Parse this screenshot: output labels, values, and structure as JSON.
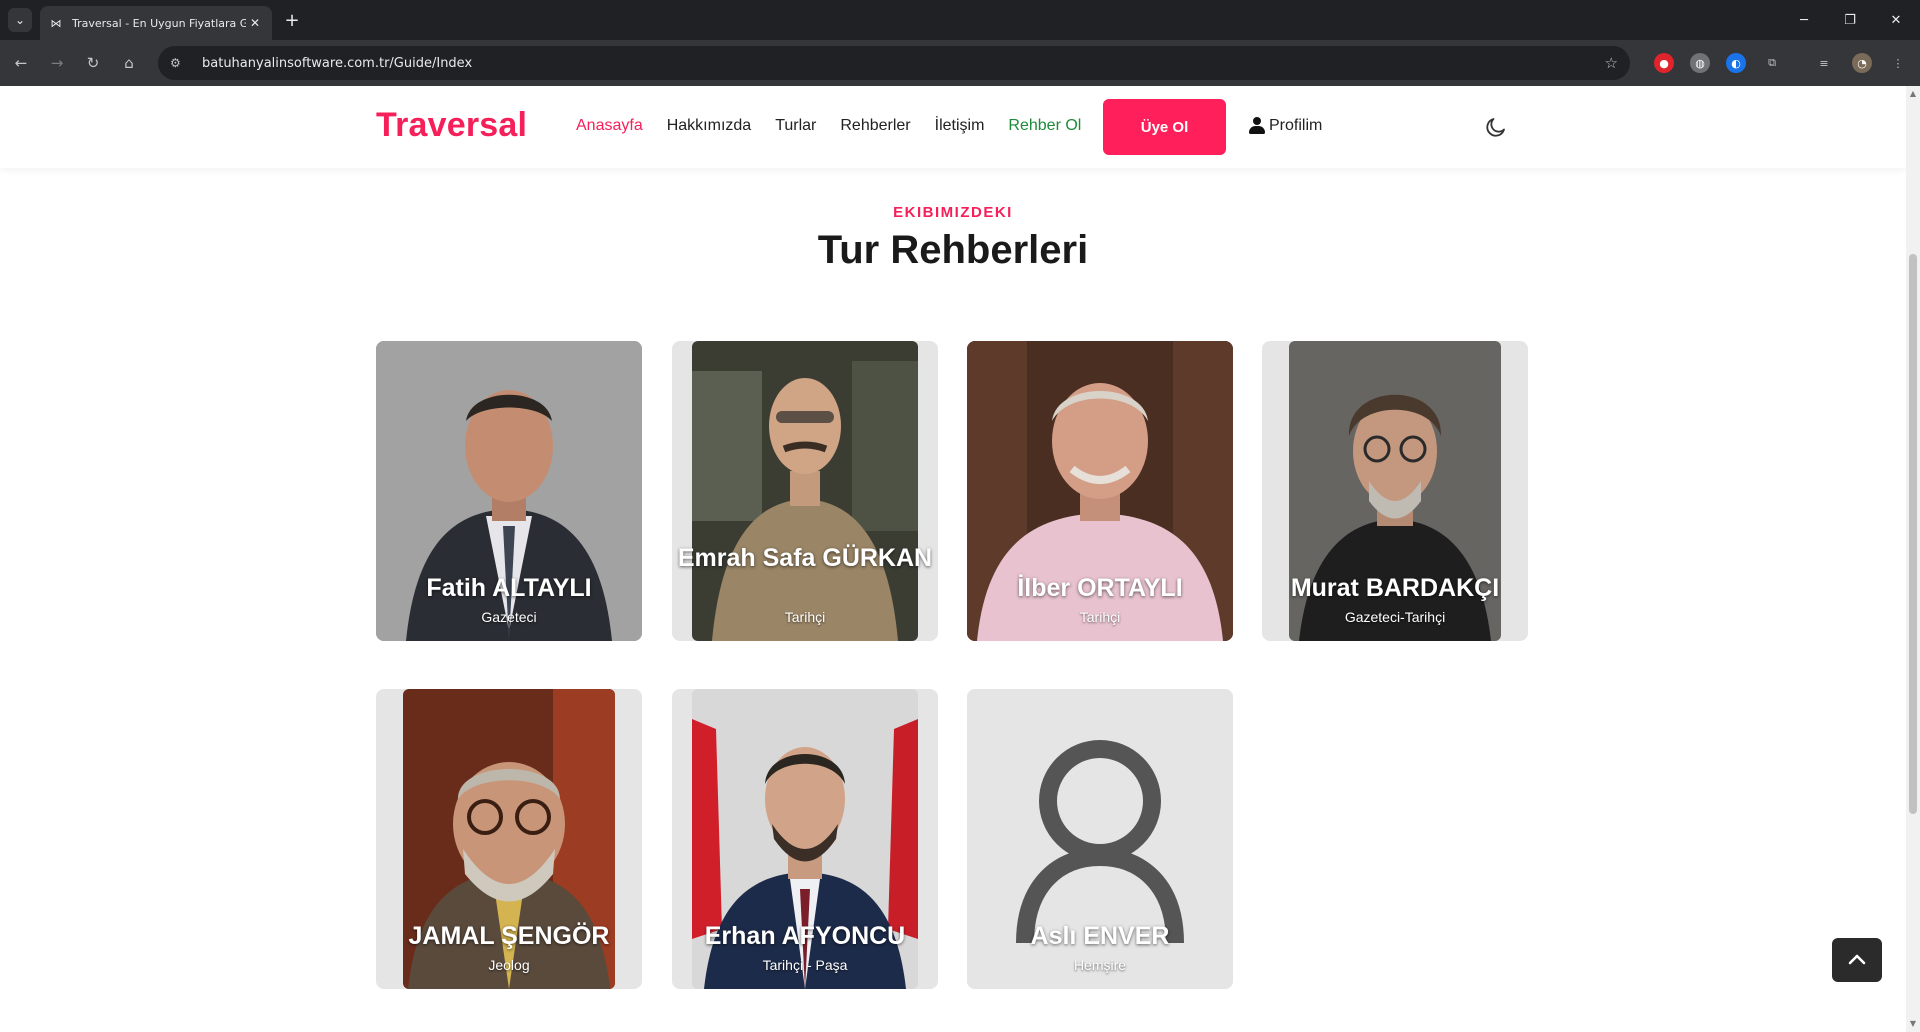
{
  "browser": {
    "tab_title": "Traversal - En Uygun Fiyatlara G",
    "url": "batuhanyalinsoftware.com.tr/Guide/Index"
  },
  "nav": {
    "brand": "Traversal",
    "links": [
      "Anasayfa",
      "Hakkımızda",
      "Turlar",
      "Rehberler",
      "İletişim",
      "Rehber Ol"
    ],
    "signup_label": "Üye Ol",
    "profile_label": "Profilim"
  },
  "section": {
    "kicker": "EKIBIMIZDEKI",
    "title": "Tur Rehberleri"
  },
  "guides": [
    {
      "name": "Fatih ALTAYLI",
      "role": "Gazeteci"
    },
    {
      "name": "Emrah Safa GÜRKAN",
      "role": "Tarihçi"
    },
    {
      "name": "İlber ORTAYLI",
      "role": "Tarihçi"
    },
    {
      "name": "Murat BARDAKÇI",
      "role": "Gazeteci-Tarihçi"
    },
    {
      "name": "JAMAL ŞENGÖR",
      "role": "Jeolog"
    },
    {
      "name": "Erhan AFYONCU",
      "role": "Tarihçi - Paşa"
    },
    {
      "name": "Aslı ENVER",
      "role": "Hemşire"
    }
  ],
  "colors": {
    "brand": "#f5205a",
    "guide_link": "#1f8a3a",
    "card_bg": "#e5e5e5"
  },
  "icons": {
    "nav_back": "back-arrow-icon",
    "nav_forward": "forward-arrow-icon",
    "reload": "reload-icon",
    "home": "home-icon",
    "bookmark": "star-icon",
    "profile": "user-icon",
    "theme": "moon-icon",
    "scroll_top": "chevron-up-icon"
  }
}
